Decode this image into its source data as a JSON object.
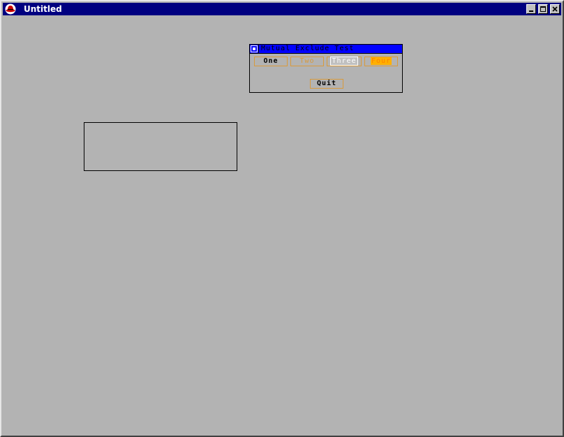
{
  "window": {
    "title": "Untitled",
    "app_icon": "redhat-logo-icon",
    "controls": {
      "minimize_icon": "minimize-icon",
      "maximize_icon": "maximize-icon",
      "close_icon": "close-icon"
    },
    "colors": {
      "titlebar": "#000080",
      "background": "#b3b3b3"
    }
  },
  "dialog": {
    "title": "Mutual Exclude Test",
    "close_icon": "dialog-close-icon",
    "buttons": [
      {
        "label": "One",
        "state": "selected"
      },
      {
        "label": "Two",
        "state": "unselected"
      },
      {
        "label": "Three",
        "state": "unselected"
      },
      {
        "label": "Four",
        "state": "unselected"
      }
    ],
    "quit_label": "Quit",
    "colors": {
      "titlebar": "#0000ff",
      "button_border": "#d89a3c",
      "four_highlight": "#ffb000"
    }
  }
}
